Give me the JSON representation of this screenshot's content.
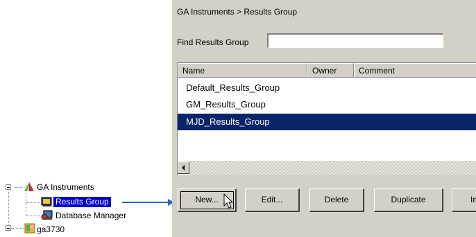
{
  "tree": {
    "items": [
      {
        "label": "GA Instruments",
        "icon": "pyramid-icon"
      },
      {
        "label": "Results Group",
        "icon": "results-group-icon",
        "selected": true
      },
      {
        "label": "Database Manager",
        "icon": "database-manager-icon"
      },
      {
        "label": "ga3730",
        "icon": "instrument-icon"
      }
    ]
  },
  "panel": {
    "breadcrumb": "GA Instruments > Results Group",
    "find": {
      "label": "Find Results Group",
      "value": "",
      "placeholder": ""
    },
    "table": {
      "columns": [
        "Name",
        "Owner",
        "Comment"
      ],
      "rows": [
        {
          "name": "Default_Results_Group",
          "owner": "",
          "comment": ""
        },
        {
          "name": "GM_Results_Group",
          "owner": "",
          "comment": ""
        },
        {
          "name": "MJD_Results_Group",
          "owner": "",
          "comment": "",
          "selected": true
        }
      ]
    },
    "buttons": {
      "new": "New...",
      "edit": "Edit...",
      "delete": "Delete",
      "duplicate": "Duplicate",
      "import": "Im"
    }
  },
  "colors": {
    "panel_bg": "#d4d0c8",
    "selection": "#0a246a",
    "tree_selection": "#0000cc",
    "arrow": "#2b67c8"
  }
}
